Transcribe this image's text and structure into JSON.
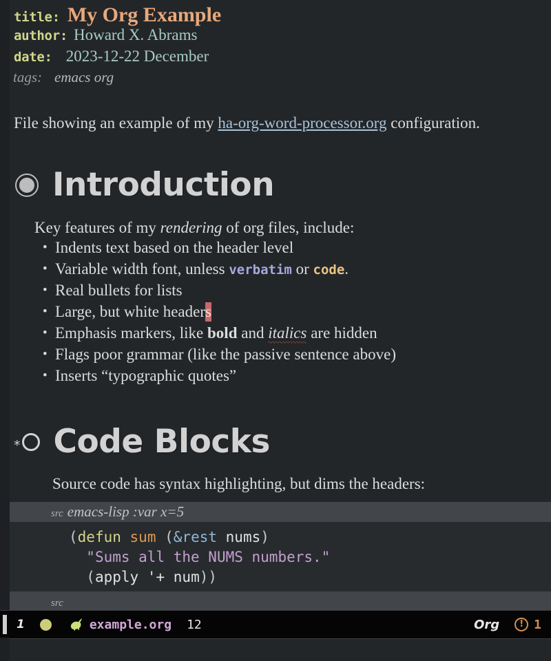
{
  "buffer": {
    "keywords": [
      {
        "label": "title:",
        "value": "My Org Example"
      },
      {
        "label": "author:",
        "value": "Howard X. Abrams"
      },
      {
        "label": "date:",
        "value": "2023-12-22 December"
      }
    ],
    "tags": {
      "label": "tags:",
      "value": "emacs org"
    },
    "intro": {
      "before": "File showing an example of my ",
      "link": "ha-org-word-processor.org",
      "after": " configuration."
    },
    "sections": [
      {
        "heading": "Introduction",
        "bullet_icon": "ring-bullet-icon",
        "lead": {
          "before": "Key features of my ",
          "emph": "rendering",
          "after": " of org files, include:"
        },
        "items": [
          {
            "text": "Indents text based on the header level"
          },
          {
            "prefix": "Variable width font, unless ",
            "verbatim": "verbatim",
            "middle": " or ",
            "code": "code",
            "suffix": "."
          },
          {
            "text": "Real bullets for lists"
          },
          {
            "prefix": "Large, but white header",
            "cursor_char": "s"
          },
          {
            "prefix": "Emphasis markers, like ",
            "bold": "bold",
            "middle": " and ",
            "italic": "italics",
            "suffix": " are hidden"
          },
          {
            "text": "Flags poor grammar (like the passive sentence above)"
          },
          {
            "text": "Inserts “typographic quotes”"
          }
        ]
      },
      {
        "heading": "Code Blocks",
        "star": "*",
        "bullet_icon": "open-circle-bullet-icon",
        "lead": "Source code has syntax highlighting, but dims the headers:",
        "src_block": {
          "begin_label": "src",
          "begin_args": "emacs-lisp :var x=5",
          "end_label": "src",
          "lines": [
            [
              {
                "t": "(",
                "c": "paren"
              },
              {
                "t": "defun",
                "c": "kw"
              },
              {
                "t": " ",
                "c": "var"
              },
              {
                "t": "sum",
                "c": "fn"
              },
              {
                "t": " (",
                "c": "paren"
              },
              {
                "t": "&rest",
                "c": "arg"
              },
              {
                "t": " ",
                "c": "var"
              },
              {
                "t": "nums",
                "c": "var"
              },
              {
                "t": ")",
                "c": "paren"
              }
            ],
            [
              {
                "t": "  ",
                "c": "var"
              },
              {
                "t": "\"Sums all the NUMS numbers.\"",
                "c": "str"
              }
            ],
            [
              {
                "t": "  (",
                "c": "paren"
              },
              {
                "t": "apply",
                "c": "var"
              },
              {
                "t": " '+ ",
                "c": "var"
              },
              {
                "t": "num",
                "c": "var"
              },
              {
                "t": "))",
                "c": "paren"
              }
            ]
          ]
        }
      }
    ],
    "fringe_marker": "»"
  },
  "modeline": {
    "workspace_number": "1",
    "status_dot": "status-dot-icon",
    "gnu_icon": "gnu-head-icon",
    "buffer_name": "example.org",
    "column": "12",
    "major_mode": "Org",
    "warning_icon": "!",
    "warning_count": "1"
  },
  "colors": {
    "background": "#232629",
    "title": "#e8a87c",
    "keyword": "#cfd78a",
    "meta_value": "#a8ccc4",
    "link": "#a9c4da",
    "verbatim": "#a6a8e0",
    "code": "#e8c583",
    "cursor": "#c8696b",
    "fringe_marker": "#d08f55",
    "modeline_bg": "#050505",
    "buffer_name": "#d3a8d8",
    "warning": "#d08f55"
  }
}
